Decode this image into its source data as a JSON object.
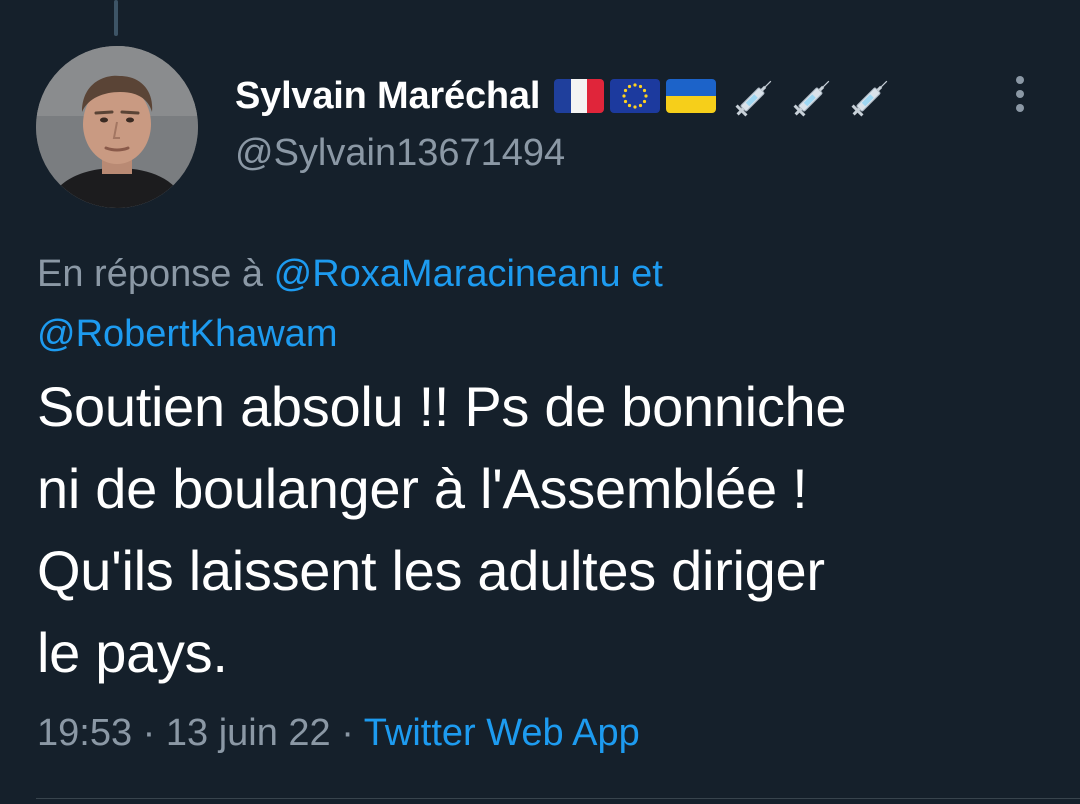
{
  "tweet": {
    "author": {
      "display_name": "Sylvain Maréchal",
      "handle": "@Sylvain13671494",
      "badges": [
        "france-flag-icon",
        "eu-flag-icon",
        "ukraine-flag-icon",
        "syringe-icon",
        "syringe-icon",
        "syringe-icon"
      ]
    },
    "reply_context": {
      "prefix": "En réponse à",
      "mention_1": "@RoxaMaracineanu",
      "conjunction": "et",
      "mention_2": "@RobertKhawam"
    },
    "text": "Soutien absolu !! Ps de bonniche\nni de boulanger à l'Assemblée !\nQu'ils laissent les adultes diriger\nle pays.",
    "time": "19:53",
    "separator": "·",
    "date": "13 juin 22",
    "source": "Twitter Web App"
  },
  "colors": {
    "background": "#15202b",
    "primary_text": "#ffffff",
    "secondary_text": "#8b98a5",
    "link": "#1d9bf0"
  }
}
